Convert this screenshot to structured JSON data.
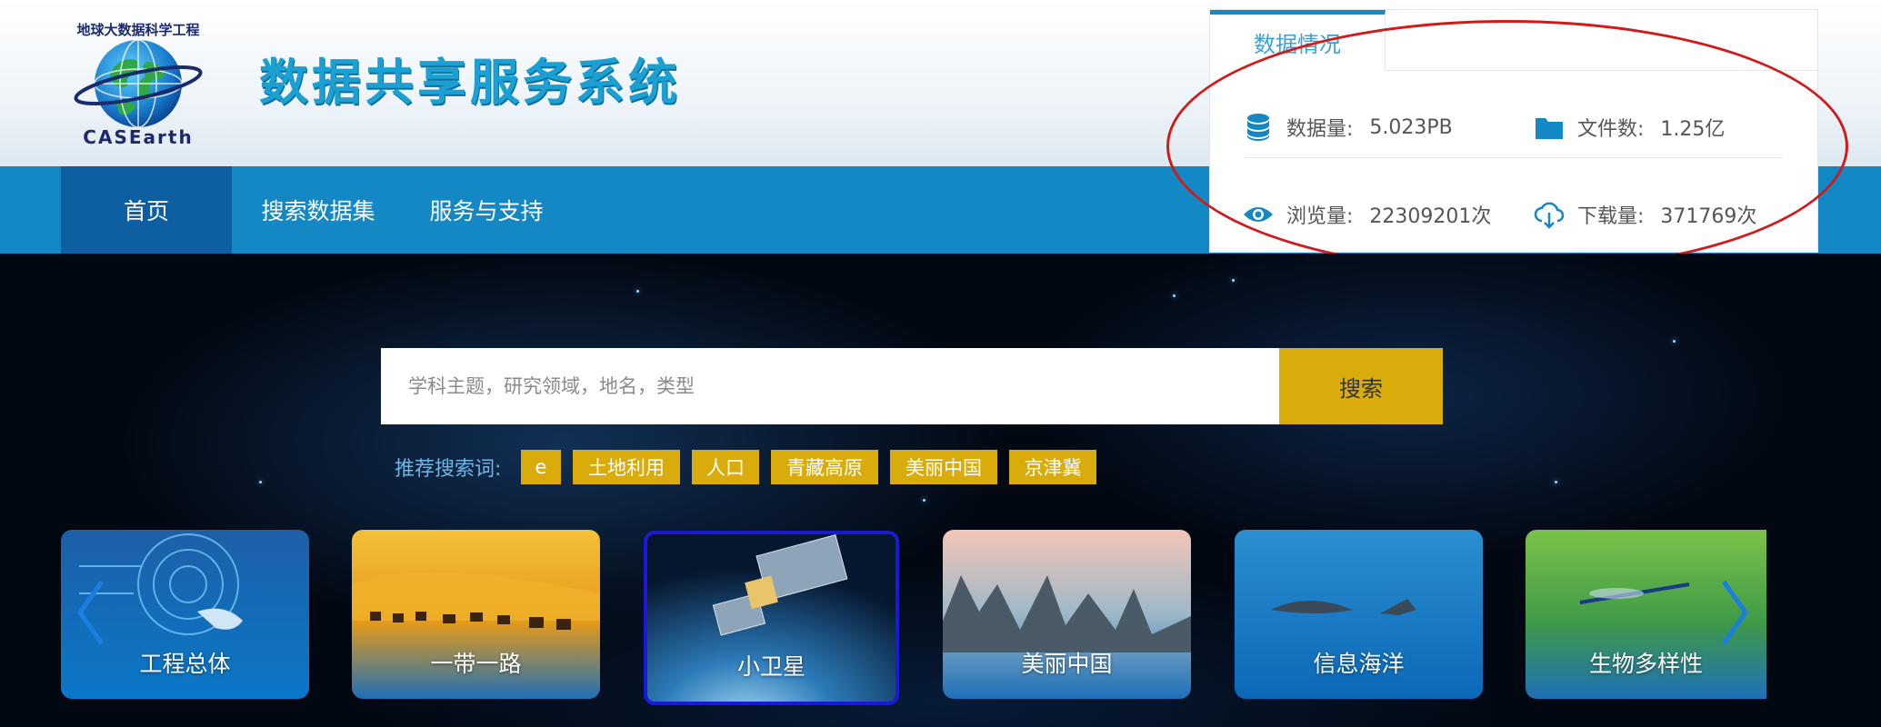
{
  "header": {
    "title": "数据共享服务系统",
    "logo": {
      "text_top": "地球大数据科学工程",
      "text_bottom": "CASEarth"
    }
  },
  "nav": {
    "items": [
      {
        "label": "首页"
      },
      {
        "label": "搜索数据集"
      },
      {
        "label": "服务与支持"
      }
    ]
  },
  "stats": {
    "tab_label": "数据情况",
    "data_volume": {
      "label": "数据量:",
      "value": "5.023PB",
      "icon": "database-icon"
    },
    "file_count": {
      "label": "文件数:",
      "value": "1.25亿",
      "icon": "folder-icon"
    },
    "views": {
      "label": "浏览量:",
      "value": "22309201次",
      "icon": "eye-icon"
    },
    "downloads": {
      "label": "下载量:",
      "value": "371769次",
      "icon": "cloud-download-icon"
    },
    "accent_color": "#1487c5",
    "annotation_color": "#d11a1a"
  },
  "search": {
    "placeholder": "学科主题，研究领域，地名，类型",
    "button_label": "搜索",
    "button_color": "#d9ab0b"
  },
  "recommend": {
    "label": "推荐搜索词:",
    "tags": [
      "e",
      "土地利用",
      "人口",
      "青藏高原",
      "美丽中国",
      "京津冀"
    ]
  },
  "carousel": {
    "cards": [
      {
        "label": "工程总体"
      },
      {
        "label": "一带一路"
      },
      {
        "label": "小卫星"
      },
      {
        "label": "美丽中国"
      },
      {
        "label": "信息海洋"
      },
      {
        "label": "生物多样性"
      }
    ],
    "active_index": 2,
    "prev_icon": "chevron-left-icon",
    "next_icon": "chevron-right-icon"
  }
}
